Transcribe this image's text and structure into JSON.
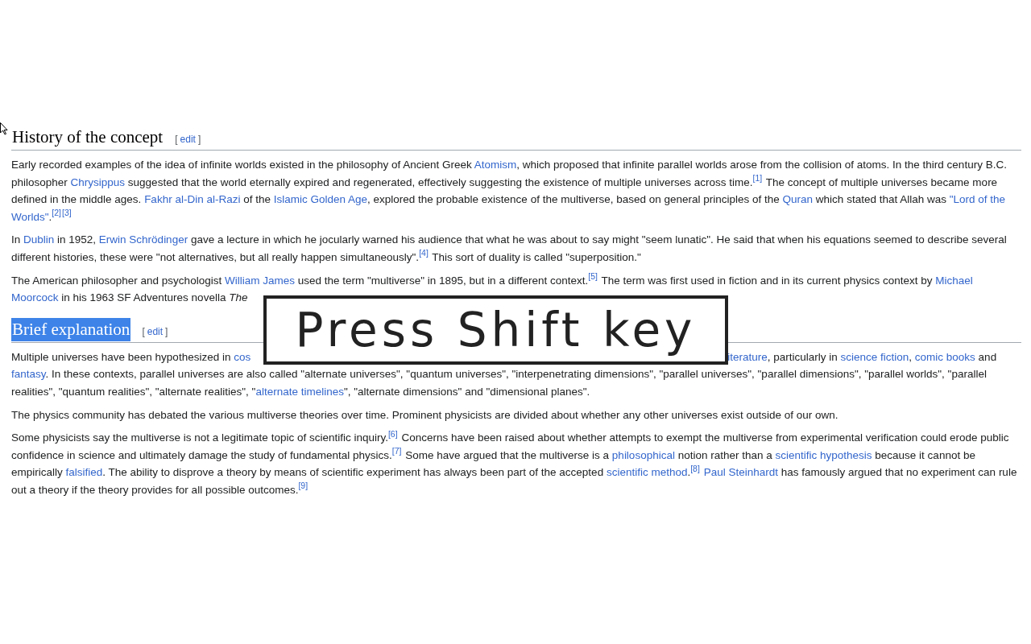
{
  "sections": [
    {
      "heading": "History of the concept",
      "selected": false,
      "edit": {
        "open": "[",
        "label": "edit",
        "close": "]"
      },
      "paragraphs": [
        [
          {
            "kind": "text",
            "text": "Early recorded examples of the idea of infinite worlds existed in the philosophy of Ancient Greek "
          },
          {
            "kind": "link",
            "text": "Atomism"
          },
          {
            "kind": "text",
            "text": ", which proposed that infinite parallel worlds arose from the collision of atoms. In the third century B.C. philosopher "
          },
          {
            "kind": "link",
            "text": "Chrysippus"
          },
          {
            "kind": "text",
            "text": " suggested that the world eternally expired and regenerated, effectively suggesting the existence of multiple universes across time."
          },
          {
            "kind": "ref",
            "text": "[1]"
          },
          {
            "kind": "text",
            "text": " The concept of multiple universes became more defined in the middle ages. "
          },
          {
            "kind": "link",
            "text": "Fakhr al-Din al-Razi"
          },
          {
            "kind": "text",
            "text": " of the "
          },
          {
            "kind": "link",
            "text": "Islamic Golden Age"
          },
          {
            "kind": "text",
            "text": ", explored the probable existence of the multiverse, based on general principles of the "
          },
          {
            "kind": "link",
            "text": "Quran"
          },
          {
            "kind": "text",
            "text": " which stated that Allah was "
          },
          {
            "kind": "link",
            "text": "\"Lord of the"
          },
          {
            "kind": "space"
          },
          {
            "kind": "link",
            "text": "Worlds\""
          },
          {
            "kind": "text",
            "text": "."
          },
          {
            "kind": "ref",
            "text": "[2]"
          },
          {
            "kind": "ref",
            "text": "[3]"
          }
        ],
        [
          {
            "kind": "text",
            "text": "In "
          },
          {
            "kind": "link",
            "text": "Dublin"
          },
          {
            "kind": "text",
            "text": " in 1952, "
          },
          {
            "kind": "link",
            "text": "Erwin Schrödinger"
          },
          {
            "kind": "text",
            "text": " gave a lecture in which he jocularly warned his audience that what he was about to say might \"seem lunatic\". He said that when his equations seemed to describe several different histories, these were \"not alternatives, but all really happen simultaneously\"."
          },
          {
            "kind": "ref",
            "text": "[4]"
          },
          {
            "kind": "text",
            "text": " This sort of duality is called \"superposition.\""
          }
        ],
        [
          {
            "kind": "text",
            "text": "The American philosopher and psychologist "
          },
          {
            "kind": "link",
            "text": "William James"
          },
          {
            "kind": "text",
            "text": " used the term \"multiverse\" in 1895, but in a different context."
          },
          {
            "kind": "ref",
            "text": "[5]"
          },
          {
            "kind": "text",
            "text": " The term was first used in fiction and in its current physics context by "
          },
          {
            "kind": "link",
            "text": "Michael"
          },
          {
            "kind": "space"
          },
          {
            "kind": "link",
            "text": "Moorcock"
          },
          {
            "kind": "text",
            "text": " in his 1963 SF Adventures novella "
          },
          {
            "kind": "italic",
            "text": "The"
          },
          {
            "kind": "covered"
          }
        ]
      ]
    },
    {
      "heading": "Brief explanation",
      "selected": true,
      "edit": {
        "open": "[",
        "label": "edit",
        "close": "]"
      },
      "paragraphs": [
        [
          {
            "kind": "text",
            "text": "Multiple universes have been hypothesized in "
          },
          {
            "kind": "link",
            "text": "cos"
          },
          {
            "kind": "covered"
          },
          {
            "kind": "link",
            "text": "iterature"
          },
          {
            "kind": "text",
            "text": ", particularly in "
          },
          {
            "kind": "link",
            "text": "science fiction"
          },
          {
            "kind": "text",
            "text": ", "
          },
          {
            "kind": "link",
            "text": "comic books"
          },
          {
            "kind": "text",
            "text": " and "
          },
          {
            "kind": "link",
            "text": "fantasy"
          },
          {
            "kind": "text",
            "text": ". In these contexts, parallel universes are also called \"alternate universes\", \"quantum universes\", \"interpenetrating dimensions\", \"parallel universes\", \"parallel dimensions\", \"parallel worlds\", \"parallel realities\", \"quantum realities\", \"alternate realities\", \""
          },
          {
            "kind": "link",
            "text": "alternate timelines"
          },
          {
            "kind": "text",
            "text": "\", \"alternate dimensions\" and \"dimensional planes\"."
          }
        ],
        [
          {
            "kind": "text",
            "text": "The physics community has debated the various multiverse theories over time. Prominent physicists are divided about whether any other universes exist outside of our own."
          }
        ],
        [
          {
            "kind": "text",
            "text": "Some physicists say the multiverse is not a legitimate topic of scientific inquiry."
          },
          {
            "kind": "ref",
            "text": "[6]"
          },
          {
            "kind": "text",
            "text": " Concerns have been raised about whether attempts to exempt the multiverse from experimental verification could erode public confidence in science and ultimately damage the study of fundamental physics."
          },
          {
            "kind": "ref",
            "text": "[7]"
          },
          {
            "kind": "text",
            "text": " Some have argued that the multiverse is a "
          },
          {
            "kind": "link",
            "text": "philosophical"
          },
          {
            "kind": "text",
            "text": " notion rather than a "
          },
          {
            "kind": "link",
            "text": "scientific hypothesis"
          },
          {
            "kind": "text",
            "text": " because it cannot be empirically "
          },
          {
            "kind": "link",
            "text": "falsified"
          },
          {
            "kind": "text",
            "text": ". The ability to disprove a theory by means of scientific experiment has always been part of the accepted "
          },
          {
            "kind": "link",
            "text": "scientific method"
          },
          {
            "kind": "text",
            "text": "."
          },
          {
            "kind": "ref",
            "text": "[8]"
          },
          {
            "kind": "space"
          },
          {
            "kind": "link",
            "text": "Paul Steinhardt"
          },
          {
            "kind": "text",
            "text": " has famously argued that no experiment can rule out a theory if the theory provides for all possible outcomes."
          },
          {
            "kind": "ref",
            "text": "[9]"
          }
        ]
      ]
    }
  ],
  "overlay": {
    "text": "Press Shift key"
  }
}
